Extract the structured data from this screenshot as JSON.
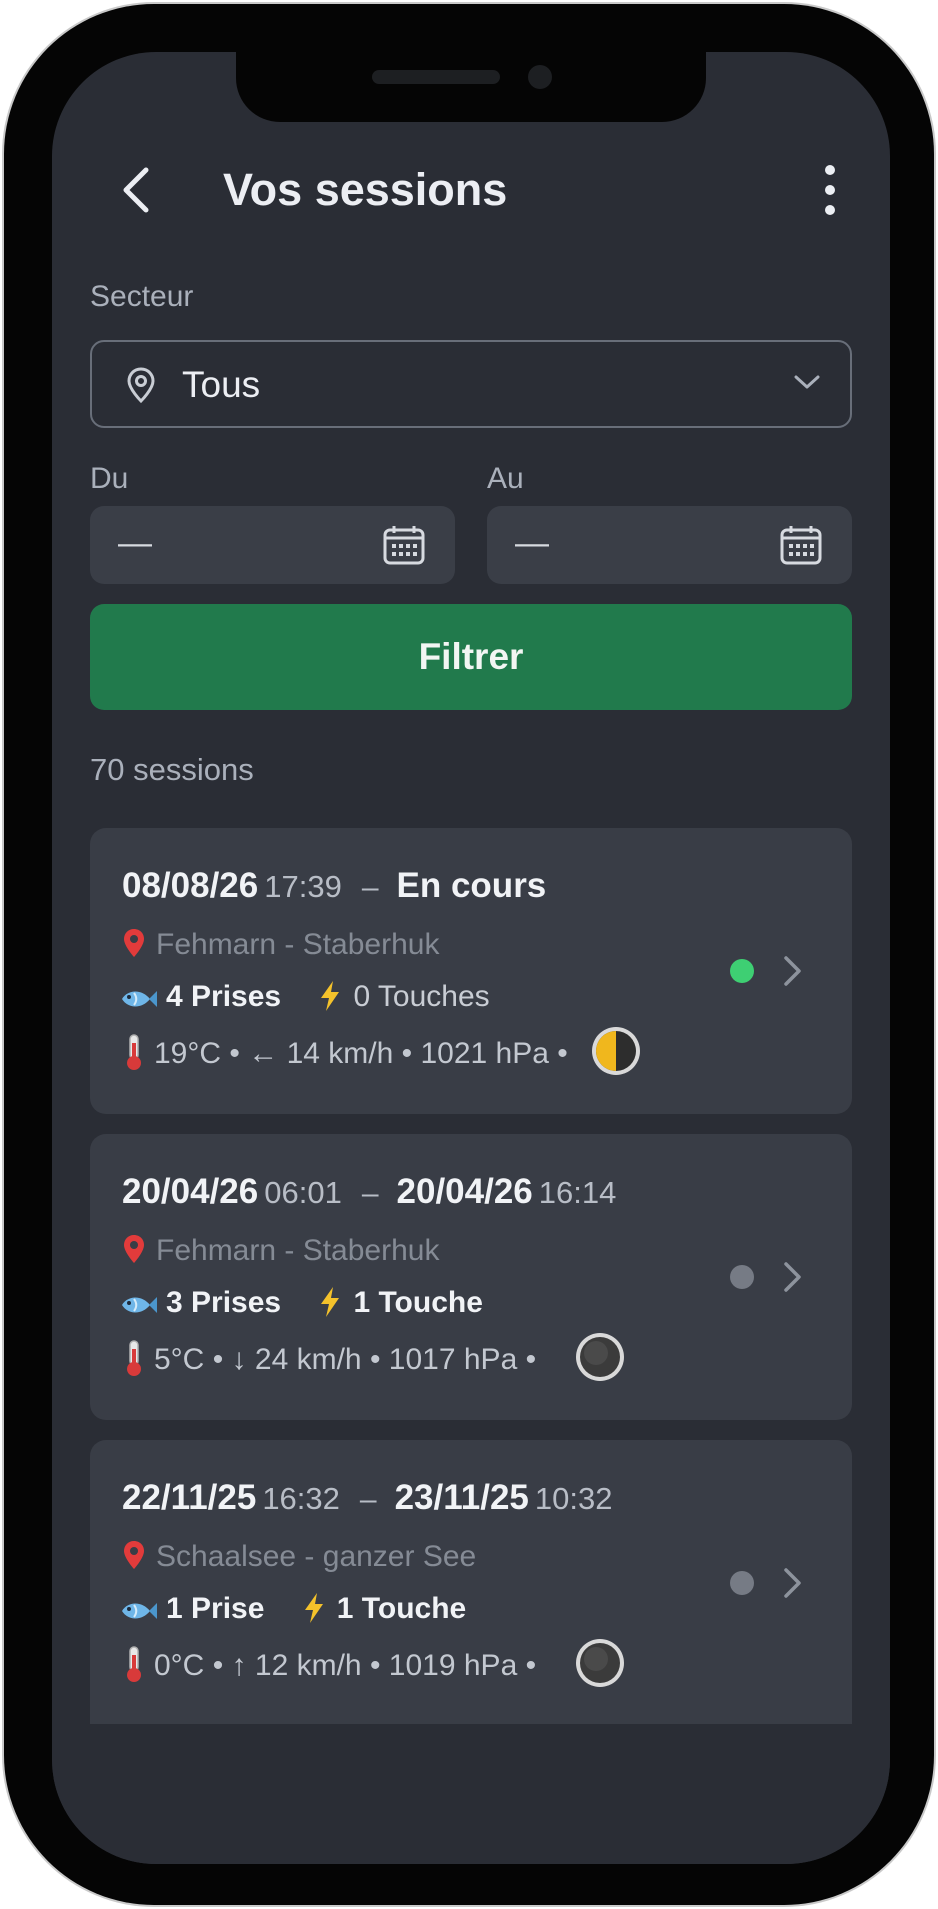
{
  "header": {
    "title": "Vos sessions"
  },
  "filters": {
    "sector_label": "Secteur",
    "sector_value": "Tous",
    "from_label": "Du",
    "from_value": "—",
    "to_label": "Au",
    "to_value": "—",
    "filter_button": "Filtrer"
  },
  "session_count": "70 sessions",
  "colors": {
    "accent_green": "#217a4c",
    "active_dot": "#3ecf73",
    "inactive_dot": "#767b85",
    "pin_red": "#e23b3b",
    "bolt_yellow": "#f4c22b"
  },
  "sessions": [
    {
      "start_date": "08/08/26",
      "start_time": "17:39",
      "separator": "–",
      "end_date": "En cours",
      "end_time": "",
      "location": "Fehmarn - Staberhuk",
      "catches": "4 Prises",
      "bites": "0 Touches",
      "temperature": "19°C",
      "wind_arrow": "←",
      "wind_speed": "14 km/h",
      "pressure": "1021 hPa",
      "moon_phase": "first-quarter",
      "status": "active"
    },
    {
      "start_date": "20/04/26",
      "start_time": "06:01",
      "separator": "–",
      "end_date": "20/04/26",
      "end_time": "16:14",
      "location": "Fehmarn - Staberhuk",
      "catches": "3 Prises",
      "bites": "1 Touche",
      "temperature": "5°C",
      "wind_arrow": "↓",
      "wind_speed": "24 km/h",
      "pressure": "1017 hPa",
      "moon_phase": "new-moon",
      "status": "inactive"
    },
    {
      "start_date": "22/11/25",
      "start_time": "16:32",
      "separator": "–",
      "end_date": "23/11/25",
      "end_time": "10:32",
      "location": "Schaalsee - ganzer See",
      "catches": "1 Prise",
      "bites": "1 Touche",
      "temperature": "0°C",
      "wind_arrow": "↑",
      "wind_speed": "12 km/h",
      "pressure": "1019 hPa",
      "moon_phase": "new-moon",
      "status": "inactive"
    }
  ],
  "icons": {
    "back": "back-arrow-icon",
    "menu": "more-vertical-icon",
    "location": "location-pin-icon",
    "dropdown": "chevron-down-icon",
    "calendar": "calendar-icon",
    "fish": "fish-icon",
    "bolt": "lightning-icon",
    "thermometer": "thermometer-icon",
    "chevron": "chevron-right-icon"
  }
}
